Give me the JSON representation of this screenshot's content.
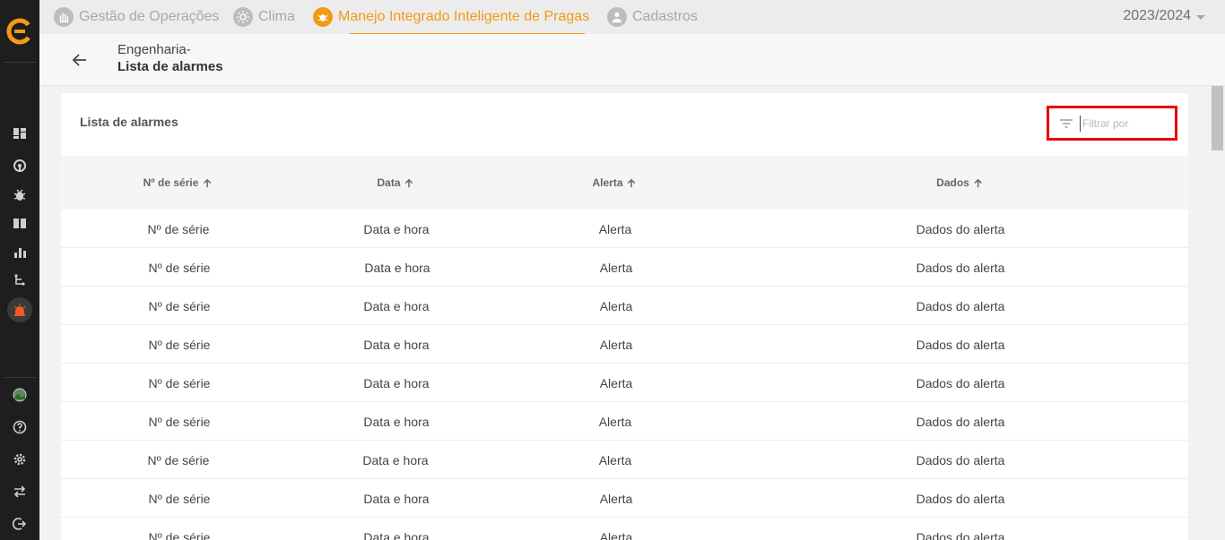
{
  "app": {
    "brand_color": "#f39a14",
    "sidebar_color": "#1e1e1e",
    "highlight_color": "#e60000"
  },
  "topnav": {
    "tabs": [
      {
        "label": "Gestão de Operações",
        "icon": "hand-icon",
        "active": false
      },
      {
        "label": "Clima",
        "icon": "sun-icon",
        "active": false
      },
      {
        "label": "Manejo Integrado Inteligente de Pragas",
        "icon": "bug-icon",
        "active": true
      },
      {
        "label": "Cadastros",
        "icon": "person-icon",
        "active": false
      }
    ],
    "season": "2023/2024"
  },
  "sidebar": {
    "items": [
      {
        "icon": "dashboard-icon"
      },
      {
        "icon": "radar-icon"
      },
      {
        "icon": "bug-icon"
      },
      {
        "icon": "book-icon"
      },
      {
        "icon": "bar-chart-icon"
      },
      {
        "icon": "flow-icon"
      },
      {
        "icon": "alarm-icon",
        "active": true
      }
    ],
    "bottom_items": [
      {
        "icon": "avatar-icon"
      },
      {
        "icon": "help-icon"
      },
      {
        "icon": "settings-icon"
      },
      {
        "icon": "swap-icon"
      },
      {
        "icon": "logout-icon"
      }
    ]
  },
  "header": {
    "parent": "Engenharia-",
    "title": "Lista de alarmes"
  },
  "card": {
    "title": "Lista de alarmes",
    "filter_placeholder": "Filtrar por"
  },
  "table": {
    "columns": [
      "Nº de série",
      "Data",
      "Alerta",
      "Dados"
    ],
    "rows": [
      [
        "Nº de série",
        "Data e hora",
        "Alerta",
        "Dados do alerta"
      ],
      [
        "Nº de série",
        "Data e hora",
        "Alerta",
        "Dados do alerta"
      ],
      [
        "Nº de série",
        "Data e hora",
        "Alerta",
        "Dados do alerta"
      ],
      [
        "Nº de série",
        "Data e hora",
        "Alerta",
        "Dados do alerta"
      ],
      [
        "Nº de série",
        "Data e hora",
        "Alerta",
        "Dados do alerta"
      ],
      [
        "Nº de série",
        "Data e hora",
        "Alerta",
        "Dados do alerta"
      ],
      [
        "Nº de série",
        "Data e hora",
        "Alerta",
        "Dados do alerta"
      ],
      [
        "Nº de série",
        "Data e hora",
        "Alerta",
        "Dados do alerta"
      ],
      [
        "Nº de série",
        "Data e hora",
        "Alerta",
        "Dados do alerta"
      ]
    ]
  }
}
